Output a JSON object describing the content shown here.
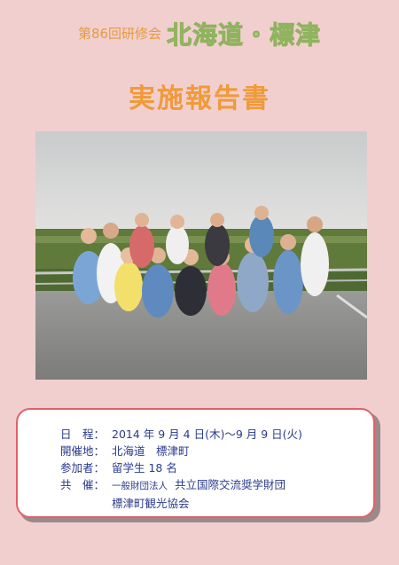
{
  "header": {
    "subtitle": "第86回研修会",
    "place": "北海道・標津",
    "report_title": "実施報告書"
  },
  "photo": {
    "description_icon": "group-photo"
  },
  "info": {
    "date_label": "日　程：",
    "date_value": "2014 年 9 月 4 日(木)～9 月 9 日(火)",
    "venue_label": "開催地：",
    "venue_value": "北海道　標津町",
    "participants_label": "参加者：",
    "participants_value": "留学生 18 名",
    "sponsor_label": "共　催：",
    "sponsor_prefix": "一般財団法人",
    "sponsor_1": "共立国際交流奨学財団",
    "sponsor_2": "標津町観光協会"
  },
  "colors": {
    "background": "#f2cfcf",
    "place_green": "#a9c977",
    "title_orange": "#f09a3a",
    "text_blue": "#2a3a8c",
    "box_border": "#e0626a"
  }
}
